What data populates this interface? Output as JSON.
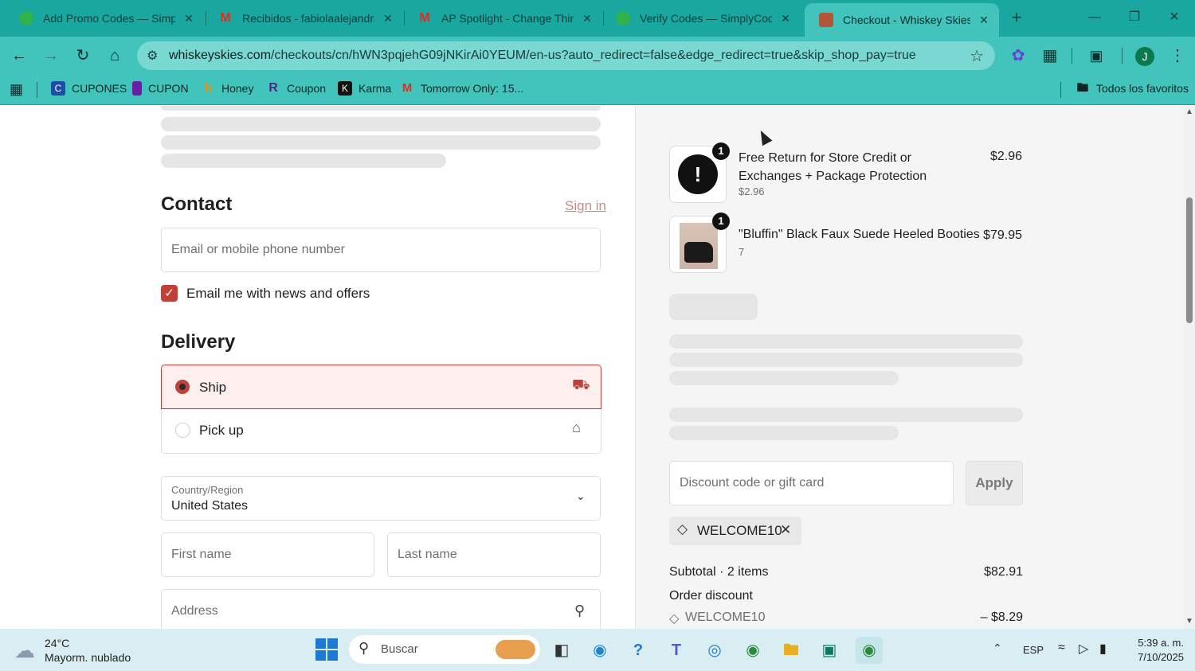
{
  "browser": {
    "tabs": [
      {
        "title": "Add Promo Codes — Simply",
        "icon_color": "#2fb34a"
      },
      {
        "title": "Recibidos - fabiolaalejandria",
        "icon_color": "#d93025"
      },
      {
        "title": "AP Spotlight - Change Thing",
        "icon_color": "#d93025"
      },
      {
        "title": "Verify Codes — SimplyCodes",
        "icon_color": "#2fb34a"
      },
      {
        "title": "Checkout - Whiskey Skies",
        "icon_color": "#b0573a"
      }
    ],
    "close_glyph": "✕",
    "new_tab_glyph": "+",
    "url_domain": "whiskeyskies.com",
    "url_path": "/checkouts/cn/hWN3pqjehG09jNKirAi0YEUM/en-us?auto_redirect=false&edge_redirect=true&skip_shop_pay=true",
    "bookmarks": [
      {
        "label": "CUPONES",
        "icon": "bookmark-icon",
        "color": "#1a4ea8"
      },
      {
        "label": "CUPON",
        "icon": "tag-icon",
        "color": "#6a1ea8"
      },
      {
        "label": "Honey",
        "icon": "honey-icon",
        "color": "#f28b00"
      },
      {
        "label": "Coupon",
        "icon": "coupon-icon",
        "color": "#4b2a86"
      },
      {
        "label": "Karma",
        "icon": "karma-icon",
        "color": "#111111"
      },
      {
        "label": "Tomorrow Only: 15...",
        "icon": "gmail-icon",
        "color": "#d93025"
      }
    ],
    "all_favorites": "Todos los favoritos",
    "profile_initial": "J"
  },
  "checkout": {
    "contact": {
      "heading": "Contact",
      "sign_in": "Sign in",
      "email_placeholder": "Email or mobile phone number",
      "newsletter_label": "Email me with news and offers"
    },
    "delivery": {
      "heading": "Delivery",
      "options": [
        {
          "label": "Ship",
          "selected": true
        },
        {
          "label": "Pick up",
          "selected": false
        }
      ],
      "country_label": "Country/Region",
      "country_value": "United States",
      "first_name_placeholder": "First name",
      "last_name_placeholder": "Last name",
      "address_placeholder": "Address"
    },
    "summary": {
      "items": [
        {
          "name": "Free Return for Store Credit or Exchanges + Package Protection",
          "variant": "$2.96",
          "price": "$2.96",
          "quantity": "1"
        },
        {
          "name": "\"Bluffin\" Black Faux Suede Heeled Booties",
          "variant": "7",
          "price": "$79.95",
          "quantity": "1"
        }
      ],
      "discount_placeholder": "Discount code or gift card",
      "apply_label": "Apply",
      "applied_code": "WELCOME10",
      "subtotal_label": "Subtotal · 2 items",
      "subtotal_value": "$82.91",
      "order_discount_label": "Order discount",
      "discount_code": "WELCOME10",
      "discount_value": "– $8.29"
    }
  },
  "taskbar": {
    "temperature": "24°C",
    "weather": "Mayorm. nublado",
    "search_placeholder": "Buscar",
    "language": "ESP",
    "time": "5:39 a. m.",
    "date": "7/10/2025"
  }
}
